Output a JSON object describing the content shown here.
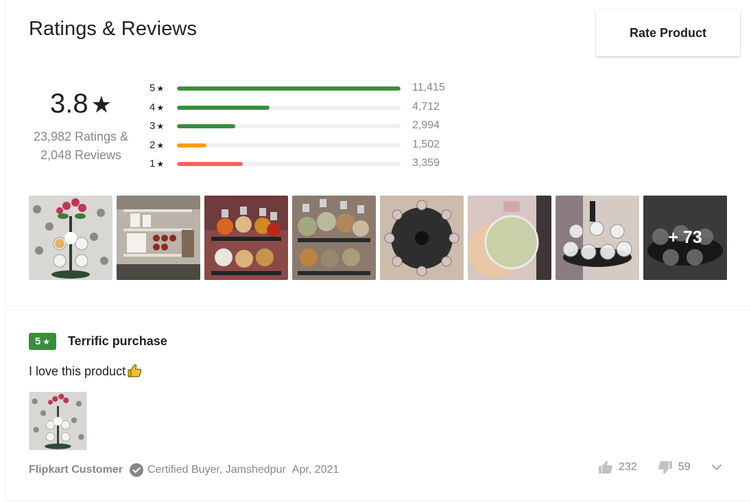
{
  "header": {
    "title": "Ratings & Reviews",
    "rate_button": "Rate Product"
  },
  "summary": {
    "average": "3.8",
    "star": "★",
    "ratings_line": "23,982 Ratings &",
    "reviews_line": "2,048 Reviews"
  },
  "distribution": [
    {
      "stars": "5",
      "count": "11,415",
      "fraction": 1.0,
      "color": "#388e3c"
    },
    {
      "stars": "4",
      "count": "4,712",
      "fraction": 0.413,
      "color": "#388e3c"
    },
    {
      "stars": "3",
      "count": "2,994",
      "fraction": 0.262,
      "color": "#388e3c"
    },
    {
      "stars": "2",
      "count": "1,502",
      "fraction": 0.132,
      "color": "#ff9f00"
    },
    {
      "stars": "1",
      "count": "3,359",
      "fraction": 0.294,
      "color": "#ff6161"
    }
  ],
  "gallery": {
    "more_label": "+ 73"
  },
  "review": {
    "rating": "5",
    "star": "★",
    "title": "Terrific purchase",
    "text": "I love this product",
    "author": "Flipkart Customer",
    "certified": "Certified Buyer, Jamshedpur",
    "date": "Apr, 2021",
    "likes": "232",
    "dislikes": "59"
  }
}
